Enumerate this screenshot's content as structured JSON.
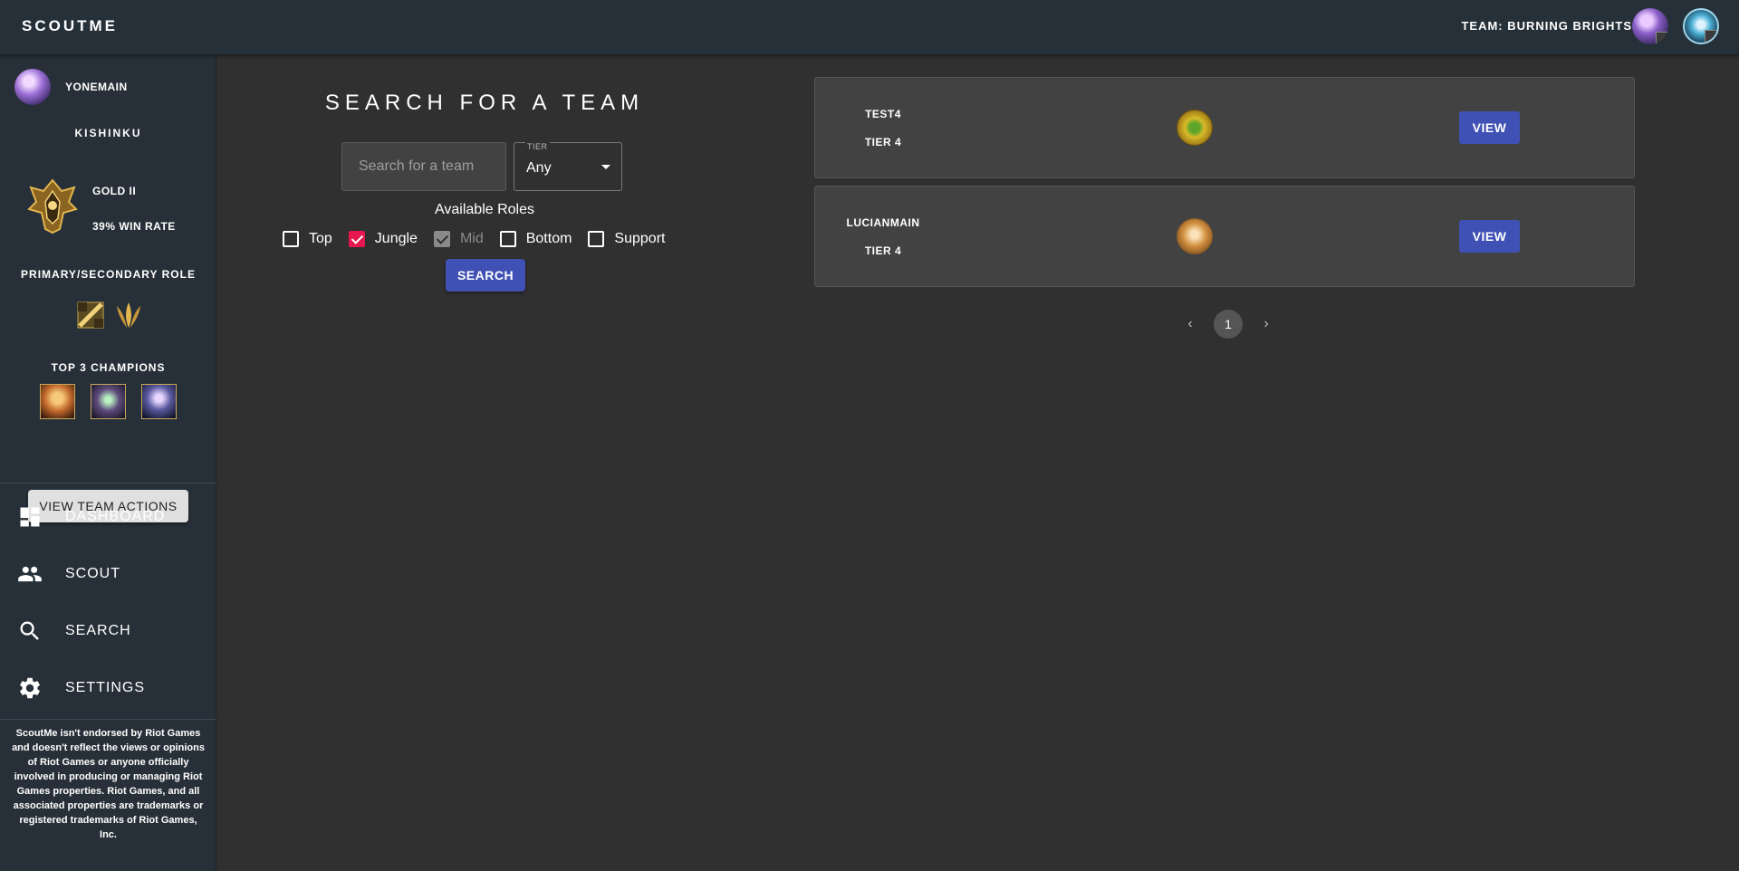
{
  "header": {
    "brand": "SCOUTME",
    "team_label": "TEAM: BURNING BRIGHTS"
  },
  "sidebar": {
    "username": "YONEMAIN",
    "summoner": "KISHINKU",
    "rank": "GOLD II",
    "win_rate": "39% WIN RATE",
    "roles_title": "PRIMARY/SECONDARY ROLE",
    "champions_title": "TOP 3 CHAMPIONS",
    "team_actions_label": "VIEW TEAM ACTIONS",
    "nav": [
      {
        "label": "DASHBOARD",
        "icon": "dashboard-icon"
      },
      {
        "label": "SCOUT",
        "icon": "people-icon"
      },
      {
        "label": "SEARCH",
        "icon": "search-icon"
      },
      {
        "label": "SETTINGS",
        "icon": "gear-icon"
      }
    ],
    "disclaimer": "ScoutMe isn't endorsed by Riot Games and doesn't reflect the views or opinions of Riot Games or anyone officially involved in producing or managing Riot Games properties. Riot Games, and all associated properties are trademarks or registered trademarks of Riot Games, Inc."
  },
  "search": {
    "title": "SEARCH FOR A TEAM",
    "placeholder": "Search for a team",
    "tier_label": "TIER",
    "tier_value": "Any",
    "roles_title": "Available Roles",
    "roles": [
      {
        "label": "Top",
        "checked": false,
        "disabled": false
      },
      {
        "label": "Jungle",
        "checked": true,
        "disabled": false
      },
      {
        "label": "Mid",
        "checked": true,
        "disabled": true
      },
      {
        "label": "Bottom",
        "checked": false,
        "disabled": false
      },
      {
        "label": "Support",
        "checked": false,
        "disabled": false
      }
    ],
    "button_label": "SEARCH"
  },
  "results": [
    {
      "name": "TEST4",
      "tier": "TIER 4",
      "logo": "sprout-icon",
      "view_label": "VIEW"
    },
    {
      "name": "LUCIANMAIN",
      "tier": "TIER 4",
      "logo": "dog-icon",
      "view_label": "VIEW"
    }
  ],
  "pagination": {
    "current_page": "1"
  },
  "colors": {
    "accent": "#3f51b5",
    "checkbox_checked": "#e6174e",
    "sidebar_bg": "#273038",
    "main_bg": "#303030"
  }
}
